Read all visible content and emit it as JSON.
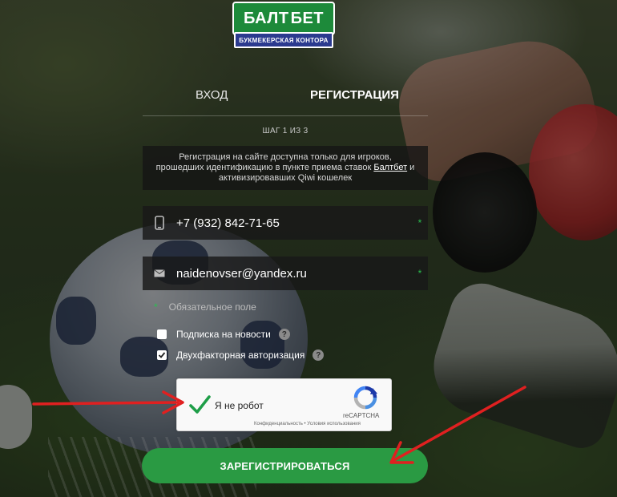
{
  "logo": {
    "brand_part1": "БАЛТ",
    "brand_part2": "БЕТ",
    "subtitle": "БУКМЕКЕРСКАЯ КОНТОРА"
  },
  "tabs": {
    "login": "ВХОД",
    "register": "РЕГИСТРАЦИЯ",
    "active": "register"
  },
  "step": "ШАГ 1 ИЗ 3",
  "info": {
    "text_before": "Регистрация на сайте доступна только для игроков, прошедших идентификацию в пункте приема ставок ",
    "link": "Балтбет",
    "text_after": " и активизировавших Qiwi кошелек"
  },
  "fields": {
    "phone": {
      "value": "+7 (932) 842-71-65",
      "icon": "phone-icon",
      "required_mark": "*"
    },
    "email": {
      "value": "naidenovser@yandex.ru",
      "icon": "envelope-icon",
      "required_mark": "*"
    }
  },
  "required_note": {
    "star": "*",
    "text": "Обязательное поле"
  },
  "checkboxes": {
    "news": {
      "label": "Подписка на новости",
      "checked": false,
      "help": "?"
    },
    "two_factor": {
      "label": "Двухфакторная авторизация",
      "checked": true,
      "help": "?"
    }
  },
  "captcha": {
    "label": "Я не робот",
    "checked": true,
    "brand": "reCAPTCHA",
    "terms": "Конфиденциальность • Условия использования"
  },
  "submit_label": "ЗАРЕГИСТРИРОВАТЬСЯ",
  "colors": {
    "accent_green": "#2a9a43",
    "required_green": "#2bbf4f",
    "annotation_red": "#e02020"
  }
}
